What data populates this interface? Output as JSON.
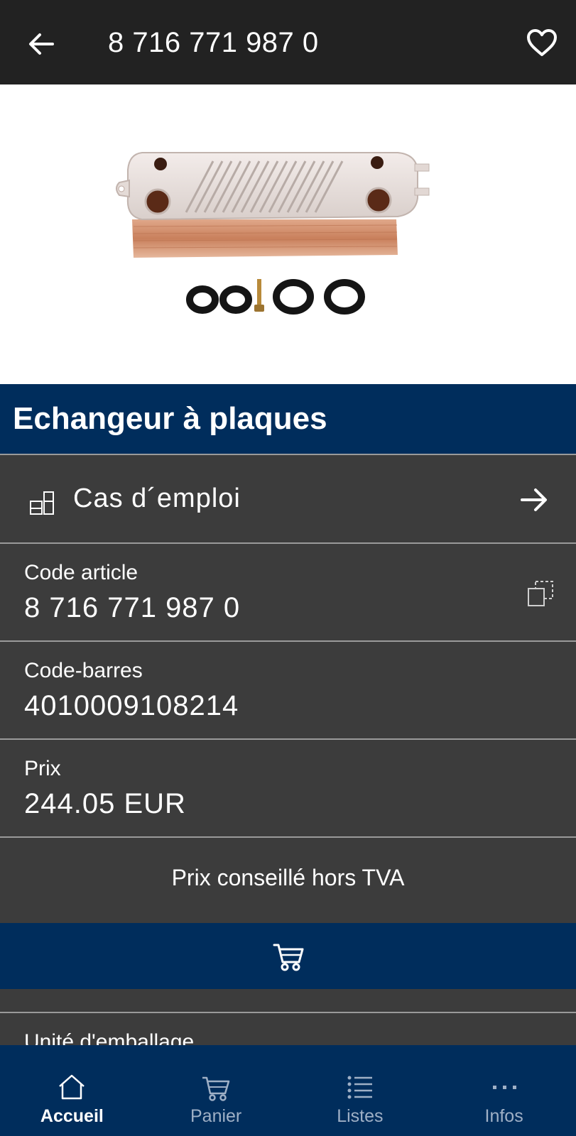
{
  "header": {
    "title": "8 716 771 987 0",
    "back_icon": "arrow-left-icon",
    "favorite_icon": "heart-outline-icon"
  },
  "product": {
    "image_alt": "Plate heat exchanger with seals and screw",
    "name": "Echangeur à plaques"
  },
  "usage": {
    "label": "Cas d´emploi",
    "icon": "boiler-parts-icon",
    "arrow_icon": "arrow-right-icon"
  },
  "details": {
    "article_code_label": "Code article",
    "article_code_value": "8 716 771 987 0",
    "copy_icon": "copy-icon",
    "barcode_label": "Code-barres",
    "barcode_value": "4010009108214",
    "price_label": "Prix",
    "price_value": "244.05 EUR",
    "price_note": "Prix conseillé hors TVA"
  },
  "cart": {
    "icon": "cart-icon"
  },
  "packaging": {
    "label": "Unité d'emballage"
  },
  "bottom_nav": {
    "items": [
      {
        "label": "Accueil",
        "icon": "home-icon",
        "active": true
      },
      {
        "label": "Panier",
        "icon": "cart-icon",
        "active": false
      },
      {
        "label": "Listes",
        "icon": "list-icon",
        "active": false
      },
      {
        "label": "Infos",
        "icon": "more-icon",
        "active": false
      }
    ]
  },
  "colors": {
    "header_bg": "#222222",
    "brand_blue": "#002d5c",
    "row_bg": "#3c3c3c",
    "divider": "#9a9a9a",
    "nav_inactive": "#9fb0c6"
  }
}
